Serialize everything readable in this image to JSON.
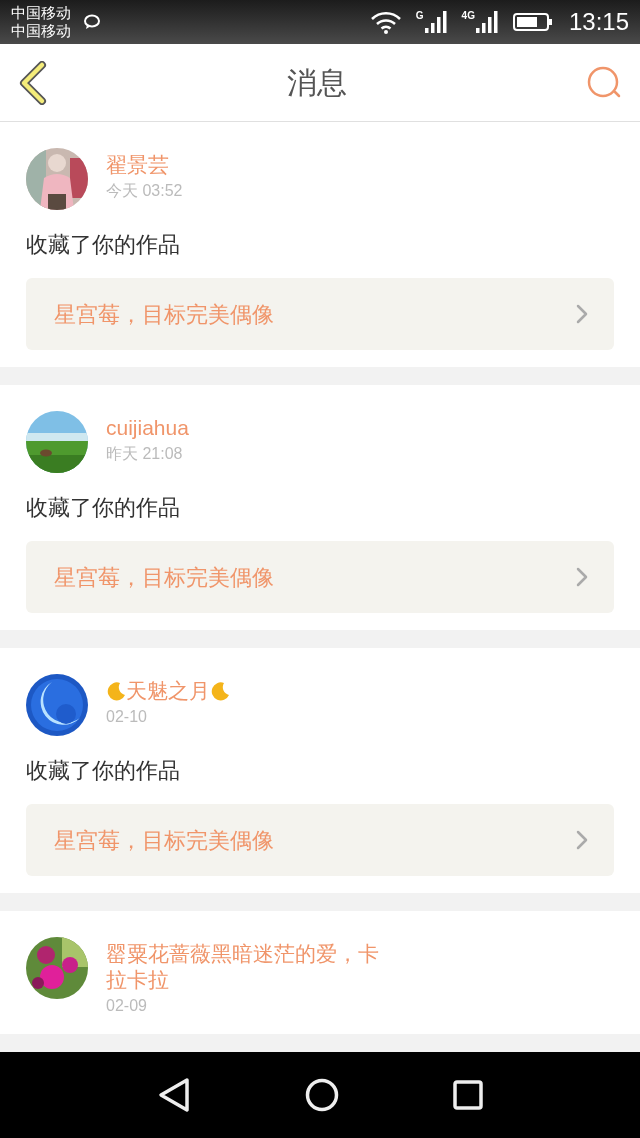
{
  "status_bar": {
    "carriers": [
      "中国移动",
      "中国移动"
    ],
    "signals": [
      {
        "label": "G"
      },
      {
        "label": "4G"
      }
    ],
    "time": "13:15"
  },
  "header": {
    "title": "消息"
  },
  "messages": [
    {
      "name": "翟景芸",
      "time": "今天 03:52",
      "action": "收藏了你的作品",
      "work": "星宫莓，目标完美偶像"
    },
    {
      "name": "cuijiahua",
      "time": "昨天 21:08",
      "action": "收藏了你的作品",
      "work": "星宫莓，目标完美偶像"
    },
    {
      "name": "天魅之月",
      "moon_marks": true,
      "time": "02-10",
      "action": "收藏了你的作品",
      "work": "星宫莓，目标完美偶像"
    },
    {
      "name": "罂粟花蔷薇黑暗迷茫的爱，卡拉卡拉",
      "time": "02-09"
    }
  ]
}
